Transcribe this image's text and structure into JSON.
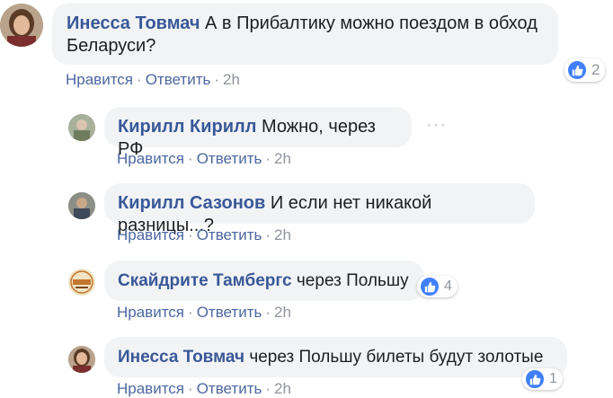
{
  "comments": [
    {
      "author": "Инесса Товмач",
      "text": "А в Прибалтику можно поездом в обход Беларуси?",
      "text_line1": "А в Прибалтику можно поездом в обход",
      "text_line2": "Беларуси?",
      "like_label": "Нравится",
      "reply_label": "Ответить",
      "time": "2h",
      "reactions": "2"
    },
    {
      "author": "Кирилл Кирилл",
      "text": "Можно, через РФ",
      "like_label": "Нравится",
      "reply_label": "Ответить",
      "time": "2h",
      "more": "···"
    },
    {
      "author": "Кирилл Сазонов",
      "text": "И если нет никакой разницы...?",
      "like_label": "Нравится",
      "reply_label": "Ответить",
      "time": "2h"
    },
    {
      "author": "Скайдрите Тамбергс",
      "text": "через Польшу",
      "like_label": "Нравится",
      "reply_label": "Ответить",
      "time": "2h",
      "reactions": "4"
    },
    {
      "author": "Инесса Товмач",
      "text": "через Польшу билеты будут золотые",
      "like_label": "Нравится",
      "reply_label": "Ответить",
      "time": "2h",
      "reactions": "1"
    }
  ],
  "separator": "·",
  "colors": {
    "link": "#385898",
    "action": "#4b67a1",
    "meta": "#90949c",
    "bubble": "#f2f3f5",
    "like_blue": "#4080ff"
  }
}
